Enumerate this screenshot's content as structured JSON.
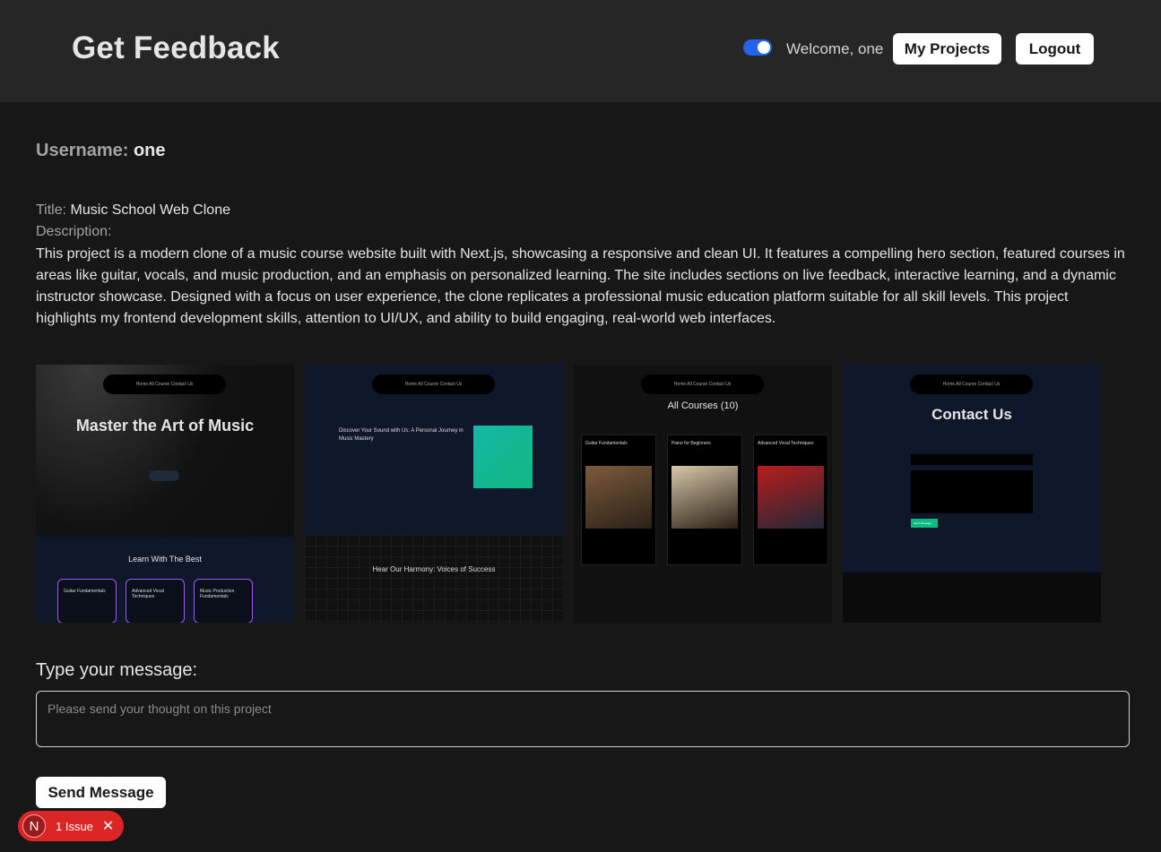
{
  "header": {
    "brand": "Get Feedback",
    "theme_toggle_on": true,
    "welcome": "Welcome, one",
    "my_projects_label": "My Projects",
    "logout_label": "Logout"
  },
  "profile": {
    "username_label": "Username:",
    "username_value": "one"
  },
  "project": {
    "title_label": "Title:",
    "title_value": "Music School Web Clone",
    "description_label": "Description:",
    "description": "This project is a modern clone of a music course website built with Next.js, showcasing a responsive and clean UI. It features a compelling hero section, featured courses in areas like guitar, vocals, and music production, and an emphasis on personalized learning. The site includes sections on live feedback, interactive learning, and a dynamic instructor showcase. Designed with a focus on user experience, the clone replicates a professional music education platform suitable for all skill levels. This project highlights my frontend development skills, attention to UI/UX, and ability to build engaging, real-world web interfaces."
  },
  "screenshots": [
    {
      "nav": "Home  All Course  Contact Us",
      "hero": "Master the Art of Music",
      "section_title": "Learn With The Best",
      "cards": [
        "Guitar Fundamentals",
        "Advanced Vocal Techniques",
        "Music Production Fundamentals"
      ]
    },
    {
      "nav": "Home  All Course  Contact Us",
      "heading": "Discover Your Sound with Us: A Personal Journey in Music Mastery",
      "section_title": "Hear Our Harmony: Voices of Success"
    },
    {
      "nav": "Home  All Course  Contact Us",
      "heading": "All Courses (10)",
      "cards": [
        "Guitar Fundamentals",
        "Piano for Beginners",
        "Advanced Vocal Techniques"
      ]
    },
    {
      "nav": "Home  All Course  Contact Us",
      "heading": "Contact Us",
      "send_label": "Send Message"
    }
  ],
  "feedback": {
    "label": "Type your message:",
    "placeholder": "Please send your thought on this project",
    "value": "",
    "send_label": "Send Message"
  },
  "dev_overlay": {
    "badge_letter": "N",
    "issues": "1 Issue",
    "close": "✕"
  },
  "colors": {
    "background": "#171717",
    "header": "#262626",
    "toggle": "#2563eb",
    "issue_pill": "#dc2626"
  }
}
